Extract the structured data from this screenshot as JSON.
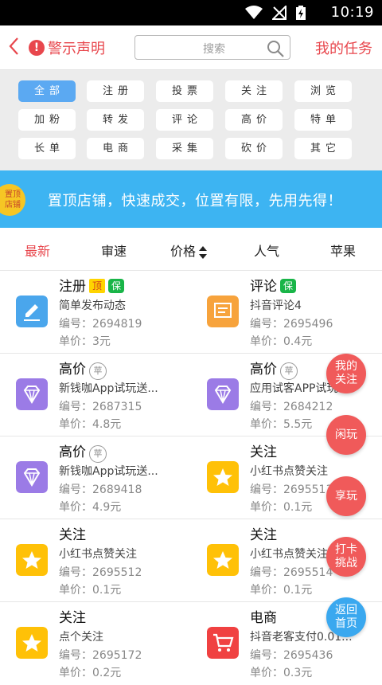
{
  "status": {
    "time": "10:19"
  },
  "header": {
    "warning_label": "警示声明",
    "search_placeholder": "搜索",
    "my_tasks_label": "我的任务"
  },
  "categories": [
    "全部",
    "注册",
    "投票",
    "关注",
    "浏览",
    "加粉",
    "转发",
    "评论",
    "高价",
    "特单",
    "长单",
    "电商",
    "采集",
    "砍价",
    "其它"
  ],
  "banner": {
    "badge_line1": "置顶",
    "badge_line2": "店铺",
    "text": "置顶店铺，快速成交，位置有限，先用先得！"
  },
  "sort": {
    "latest": "最新",
    "review_speed": "审速",
    "price": "价格",
    "popularity": "人气",
    "apple": "苹果"
  },
  "tags": {
    "top": "顶",
    "guarantee": "保",
    "ping": "苹"
  },
  "tasks": [
    {
      "title": "注册",
      "desc": "简单发布动态",
      "num": "编号：2694819",
      "price": "单价：3元",
      "icon": "pencil-icon"
    },
    {
      "title": "评论",
      "desc": "抖音评论4",
      "num": "编号：2695496",
      "price": "单价：0.4元",
      "icon": "comment-icon"
    },
    {
      "title": "高价",
      "desc": "新钱咖App试玩送...",
      "num": "编号：2687315",
      "price": "单价：4.8元",
      "icon": "diamond-icon"
    },
    {
      "title": "高价",
      "desc": "应用试客APP试玩",
      "num": "编号：2684212",
      "price": "单价：5.5元",
      "icon": "diamond-icon"
    },
    {
      "title": "高价",
      "desc": "新钱咖App试玩送...",
      "num": "编号：2689418",
      "price": "单价：4.9元",
      "icon": "diamond-icon"
    },
    {
      "title": "关注",
      "desc": "小红书点赞关注",
      "num": "编号：2695513",
      "price": "单价：0.1元",
      "icon": "star-icon"
    },
    {
      "title": "关注",
      "desc": "小红书点赞关注",
      "num": "编号：2695512",
      "price": "单价：0.1元",
      "icon": "star-icon"
    },
    {
      "title": "关注",
      "desc": "小红书点赞关注",
      "num": "编号：2695514",
      "price": "单价：0.1元",
      "icon": "star-icon"
    },
    {
      "title": "关注",
      "desc": "点个关注",
      "num": "编号：2695172",
      "price": "单价：0.2元",
      "icon": "star-icon"
    },
    {
      "title": "电商",
      "desc": "抖音老客支付0.01...",
      "num": "编号：2695436",
      "price": "单价：0.3元",
      "icon": "cart-icon"
    }
  ],
  "fabs": {
    "my_follow_1": "我的",
    "my_follow_2": "关注",
    "leisure": "闲玩",
    "enjoy": "享玩",
    "checkin_1": "打卡",
    "checkin_2": "挑战",
    "home_1": "返回",
    "home_2": "首页"
  },
  "colors": {
    "accent": "#e8474d",
    "banner": "#3db4f2",
    "active_tab": "#5ba9f2",
    "diamond": "#9b7be6",
    "star": "#ffc107",
    "comment": "#f7a33c",
    "pencil": "#4aa6ec",
    "cart": "#f04141"
  }
}
